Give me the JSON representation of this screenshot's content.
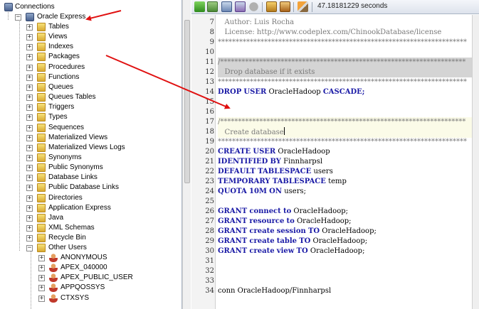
{
  "tree": {
    "root": "Connections",
    "connection": "Oracle Express",
    "nodes": [
      "Tables",
      "Views",
      "Indexes",
      "Packages",
      "Procedures",
      "Functions",
      "Queues",
      "Queues Tables",
      "Triggers",
      "Types",
      "Sequences",
      "Materialized Views",
      "Materialized Views Logs",
      "Synonyms",
      "Public Synonyms",
      "Database Links",
      "Public Database Links",
      "Directories",
      "Application Express",
      "Java",
      "XML Schemas",
      "Recycle Bin",
      "Other Users"
    ],
    "users": [
      "ANONYMOUS",
      "APEX_040000",
      "APEX_PUBLIC_USER",
      "APPQOSSYS",
      "CTXSYS"
    ]
  },
  "toolbar": {
    "elapsed": "47.18181229 seconds",
    "icons": [
      "run-icon",
      "run-script-icon",
      "commit-icon",
      "rollback-icon",
      "cancel-icon",
      "autotrace-icon",
      "explain-plan-icon",
      "clear-icon"
    ]
  },
  "editor": {
    "lines": [
      {
        "n": "7",
        "text": "   Author: Luis Rocha"
      },
      {
        "n": "8",
        "text": "   License: http://www.codeplex.com/ChinookDatabase/license"
      },
      {
        "n": "9",
        "text": "**********************************************************************"
      },
      {
        "n": "10",
        "text": ""
      },
      {
        "n": "11",
        "text": "/*********************************************************************"
      },
      {
        "n": "12",
        "text": "   Drop database if it exists"
      },
      {
        "n": "13",
        "text": "**********************************************************************"
      },
      {
        "n": "14",
        "text": "DROP USER OracleHadoop CASCADE;"
      },
      {
        "n": "15",
        "text": ""
      },
      {
        "n": "16",
        "text": ""
      },
      {
        "n": "17",
        "text": "/*********************************************************************"
      },
      {
        "n": "18",
        "text": "   Create database"
      },
      {
        "n": "19",
        "text": "**********************************************************************"
      },
      {
        "n": "20",
        "text": "CREATE USER OracleHadoop"
      },
      {
        "n": "21",
        "text": "IDENTIFIED BY Finnharpsl"
      },
      {
        "n": "22",
        "text": "DEFAULT TABLESPACE users"
      },
      {
        "n": "23",
        "text": "TEMPORARY TABLESPACE temp"
      },
      {
        "n": "24",
        "text": "QUOTA 10M ON users;"
      },
      {
        "n": "25",
        "text": ""
      },
      {
        "n": "26",
        "text": "GRANT connect to OracleHadoop;"
      },
      {
        "n": "27",
        "text": "GRANT resource to OracleHadoop;"
      },
      {
        "n": "28",
        "text": "GRANT create session TO OracleHadoop;"
      },
      {
        "n": "29",
        "text": "GRANT create table TO OracleHadoop;"
      },
      {
        "n": "30",
        "text": "GRANT create view TO OracleHadoop;"
      },
      {
        "n": "31",
        "text": ""
      },
      {
        "n": "32",
        "text": ""
      },
      {
        "n": "33",
        "text": ""
      },
      {
        "n": "34",
        "text": "conn OracleHadoop/Finnharpsl"
      }
    ]
  },
  "colors": {
    "keyword": "#1a1aa6",
    "comment": "#7a7a7a",
    "arrow": "#e01010"
  }
}
